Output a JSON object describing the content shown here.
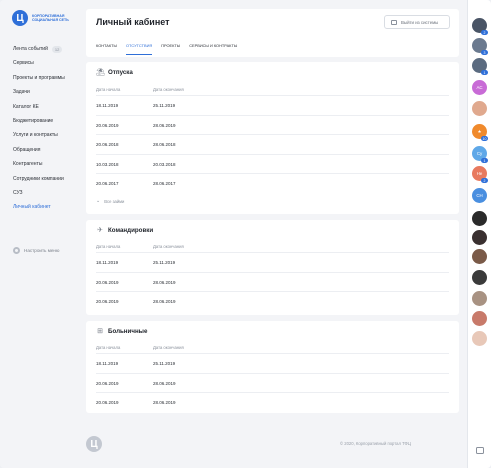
{
  "app": {
    "logo_letter": "Ц",
    "logo_text": "КОРПОРАТИВНАЯ СОЦИАЛЬНАЯ СЕТЬ"
  },
  "sidebar": {
    "items": [
      {
        "label": "Лента событий",
        "badge": "12"
      },
      {
        "label": "Сервисы"
      },
      {
        "label": "Проекты и программы"
      },
      {
        "label": "Задачи"
      },
      {
        "label": "Каталог КЕ"
      },
      {
        "label": "Бюджетирование"
      },
      {
        "label": "Услуги и контракты"
      },
      {
        "label": "Обращения"
      },
      {
        "label": "Контрагенты"
      },
      {
        "label": "Сотрудники компании"
      },
      {
        "label": "СУЗ"
      },
      {
        "label": "Личный кабинет",
        "active": true
      }
    ],
    "settings_label": "Настроить меню"
  },
  "header": {
    "title": "Личный кабинет",
    "logout_label": "Выйти из системы",
    "tabs": [
      {
        "label": "КОНТАКТЫ"
      },
      {
        "label": "ОТСУТСТВИЯ",
        "active": true
      },
      {
        "label": "ПРОЕКТЫ"
      },
      {
        "label": "СЕРВИСЫ И КОНТРАКТЫ"
      }
    ]
  },
  "vacations": {
    "title": "Отпуска",
    "icon": "beach-umbrella-icon",
    "col_start": "Дата начала",
    "col_end": "Дата окончания",
    "rows": [
      {
        "start": "18.11.2019",
        "end": "25.11.2019"
      },
      {
        "start": "20.06.2019",
        "end": "28.06.2019"
      },
      {
        "start": "20.06.2018",
        "end": "28.06.2018"
      },
      {
        "start": "10.03.2018",
        "end": "20.03.2018"
      },
      {
        "start": "20.06.2017",
        "end": "28.06.2017"
      }
    ],
    "show_all_label": "Все займи"
  },
  "trips": {
    "title": "Командировки",
    "icon": "airplane-icon",
    "col_start": "Дата начала",
    "col_end": "Дата окончания",
    "rows": [
      {
        "start": "18.11.2019",
        "end": "25.11.2019"
      },
      {
        "start": "20.06.2019",
        "end": "28.06.2019"
      },
      {
        "start": "20.06.2019",
        "end": "28.06.2019"
      }
    ]
  },
  "sick": {
    "title": "Больничные",
    "icon": "medical-kit-icon",
    "col_start": "Дата начала",
    "col_end": "Дата окончания",
    "rows": [
      {
        "start": "18.11.2019",
        "end": "25.11.2019"
      },
      {
        "start": "20.06.2019",
        "end": "28.06.2019"
      },
      {
        "start": "20.06.2019",
        "end": "28.06.2019"
      }
    ]
  },
  "footer": {
    "logo_letter": "Ц",
    "copyright": "© 2020, Корпоративный портал ТФЦ"
  },
  "rail": {
    "avatars": [
      {
        "initials": "",
        "color": "#4a5566",
        "badge": "2"
      },
      {
        "initials": "",
        "color": "#6b7a8f",
        "badge": "3"
      },
      {
        "initials": "",
        "color": "#5b6b80",
        "badge": "1"
      },
      {
        "initials": "АС",
        "color": "#c86bd6",
        "badge": ""
      },
      {
        "initials": "",
        "color": "#e0a98e",
        "badge": ""
      },
      {
        "initials": "★",
        "color": "#f08a2c",
        "badge": "10"
      },
      {
        "initials": "Су",
        "color": "#5fa8e8",
        "badge": "1"
      },
      {
        "initials": "Не",
        "color": "#e87a5f",
        "badge": "2"
      },
      {
        "initials": "СН",
        "color": "#4a8fe0",
        "badge": ""
      },
      {
        "initials": "",
        "color": "#2a2a2a",
        "badge": ""
      },
      {
        "initials": "",
        "color": "#3a3030",
        "badge": ""
      },
      {
        "initials": "",
        "color": "#7a5a48",
        "badge": ""
      },
      {
        "initials": "",
        "color": "#3b3b3b",
        "badge": ""
      },
      {
        "initials": "",
        "color": "#a89282",
        "badge": ""
      },
      {
        "initials": "",
        "color": "#c87a6a",
        "badge": ""
      },
      {
        "initials": "",
        "color": "#e8c8b8",
        "badge": ""
      }
    ]
  }
}
